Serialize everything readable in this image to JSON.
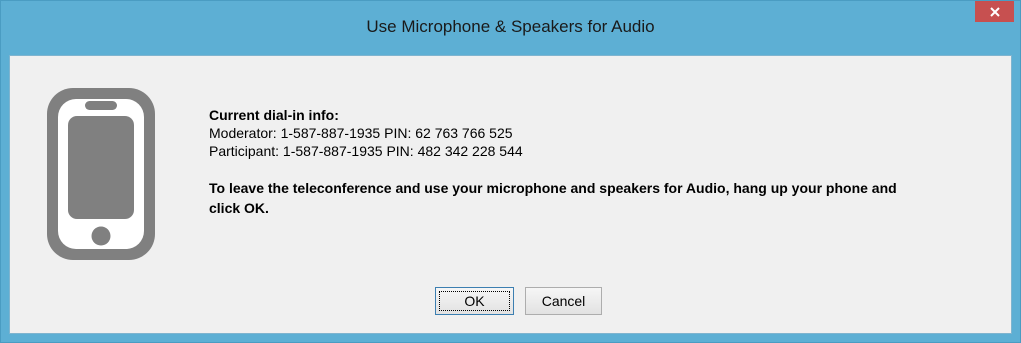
{
  "window": {
    "title": "Use Microphone & Speakers for Audio",
    "close_label": "×"
  },
  "icon": {
    "name": "phone-icon",
    "color": "#808080"
  },
  "dial_in": {
    "heading": "Current dial-in info:",
    "moderator": "Moderator: 1-587-887-1935 PIN: 62 763 766 525",
    "participant": "Participant: 1-587-887-1935 PIN: 482 342 228 544"
  },
  "instructions": "To leave the teleconference and use your microphone and speakers for Audio, hang up your phone and click OK.",
  "buttons": {
    "ok_label": "OK",
    "cancel_label": "Cancel"
  },
  "colors": {
    "titlebar": "#5dafd4",
    "close_button": "#c75050",
    "client_bg": "#f0f0f0"
  }
}
